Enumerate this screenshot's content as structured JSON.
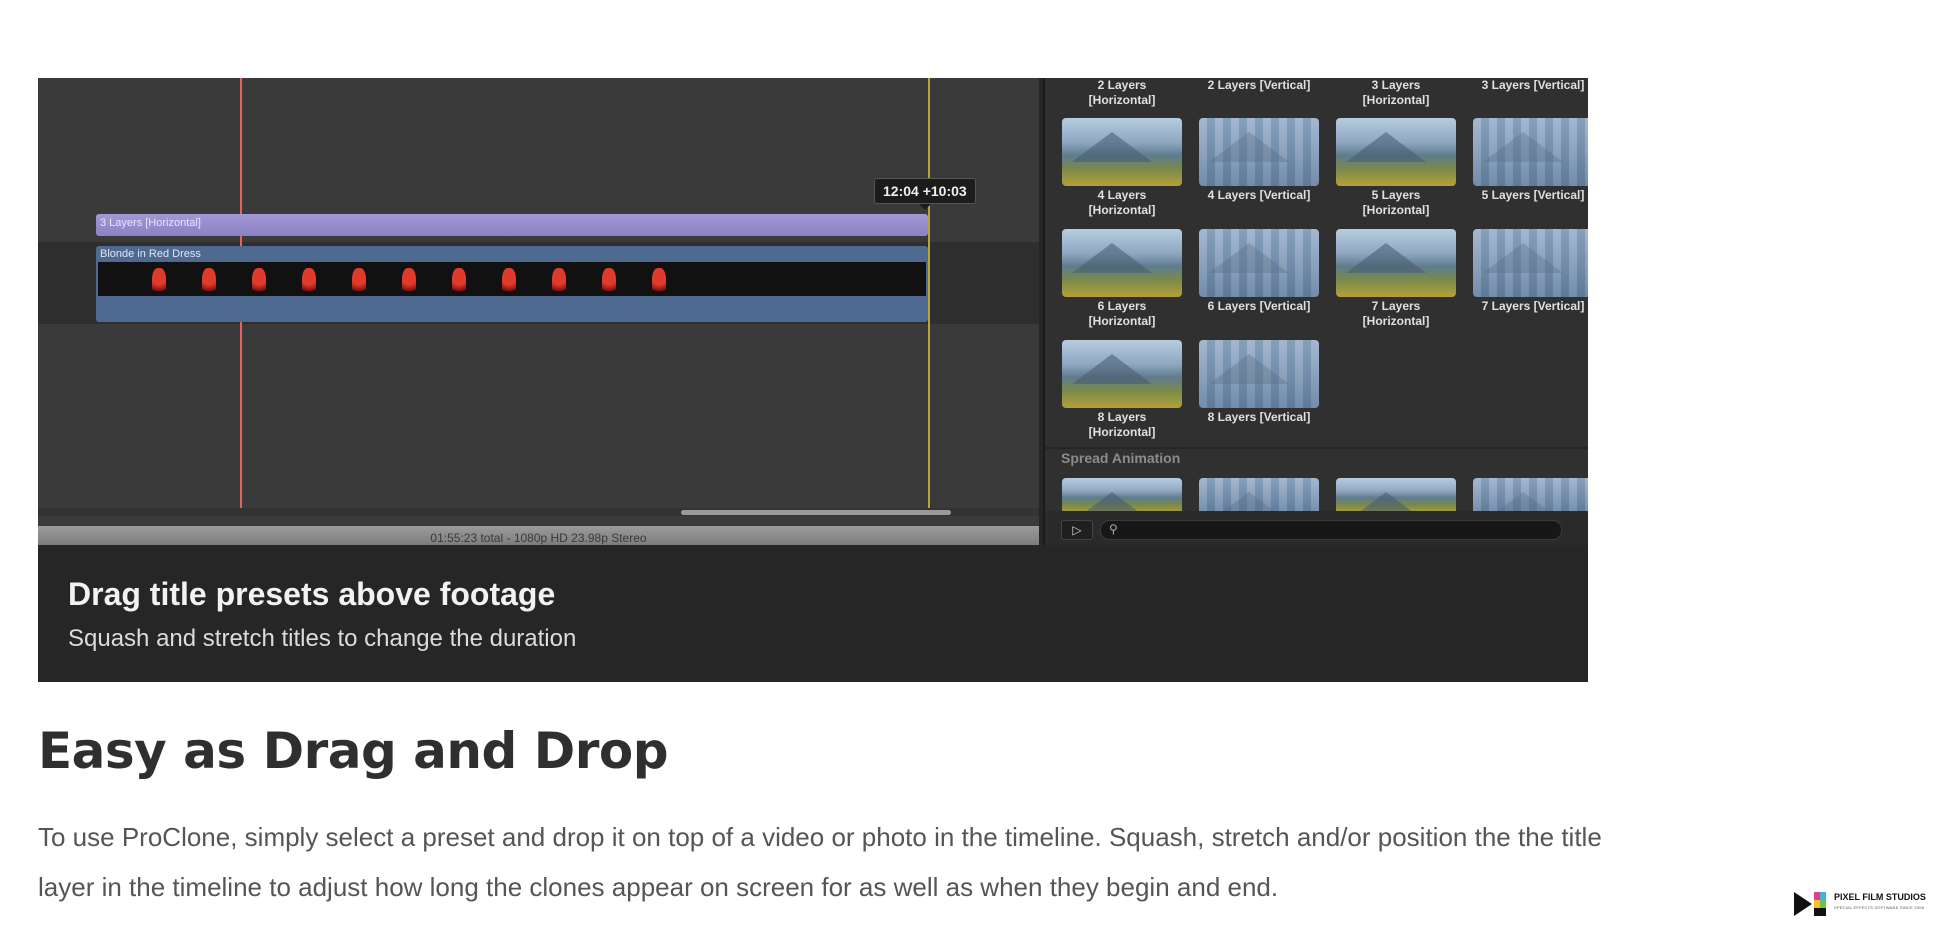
{
  "screenshot": {
    "timecode": "12:04  +10:03",
    "title_clip_label": "3 Layers [Horizontal]",
    "video_clip_label": "Blonde in Red Dress",
    "status": "01:55:23 total - 1080p HD 23.98p Stereo",
    "browser": {
      "top_row": [
        "2 Layers\n[Horizontal]",
        "2 Layers [Vertical]",
        "3 Layers\n[Horizontal]",
        "3 Layers [Vertical]"
      ],
      "presets": [
        {
          "label": "4 Layers\n[Horizontal]",
          "style": "horizontal"
        },
        {
          "label": "4 Layers [Vertical]",
          "style": "vertical"
        },
        {
          "label": "5 Layers\n[Horizontal]",
          "style": "horizontal"
        },
        {
          "label": "5 Layers [Vertical]",
          "style": "vertical"
        },
        {
          "label": "6 Layers\n[Horizontal]",
          "style": "horizontal"
        },
        {
          "label": "6 Layers [Vertical]",
          "style": "vertical"
        },
        {
          "label": "7 Layers\n[Horizontal]",
          "style": "horizontal"
        },
        {
          "label": "7 Layers [Vertical]",
          "style": "vertical"
        },
        {
          "label": "8 Layers\n[Horizontal]",
          "style": "horizontal"
        },
        {
          "label": "8 Layers [Vertical]",
          "style": "vertical"
        }
      ],
      "section_label": "Spread Animation",
      "search_icon": "search-icon"
    },
    "caption_title": "Drag title presets above footage",
    "caption_subtitle": "Squash and stretch titles to change the duration"
  },
  "section": {
    "heading": "Easy as Drag and Drop",
    "body": "To use ProClone, simply select a preset and drop it on top of a video or photo in the timeline. Squash, stretch and/or position the the title layer in the timeline to adjust how long the clones appear on screen for as well as when they begin and end."
  },
  "logo": {
    "name": "PIXEL FILM STUDIOS",
    "tagline": "SPECIAL EFFECTS SOFTWARE SINCE 2008"
  }
}
